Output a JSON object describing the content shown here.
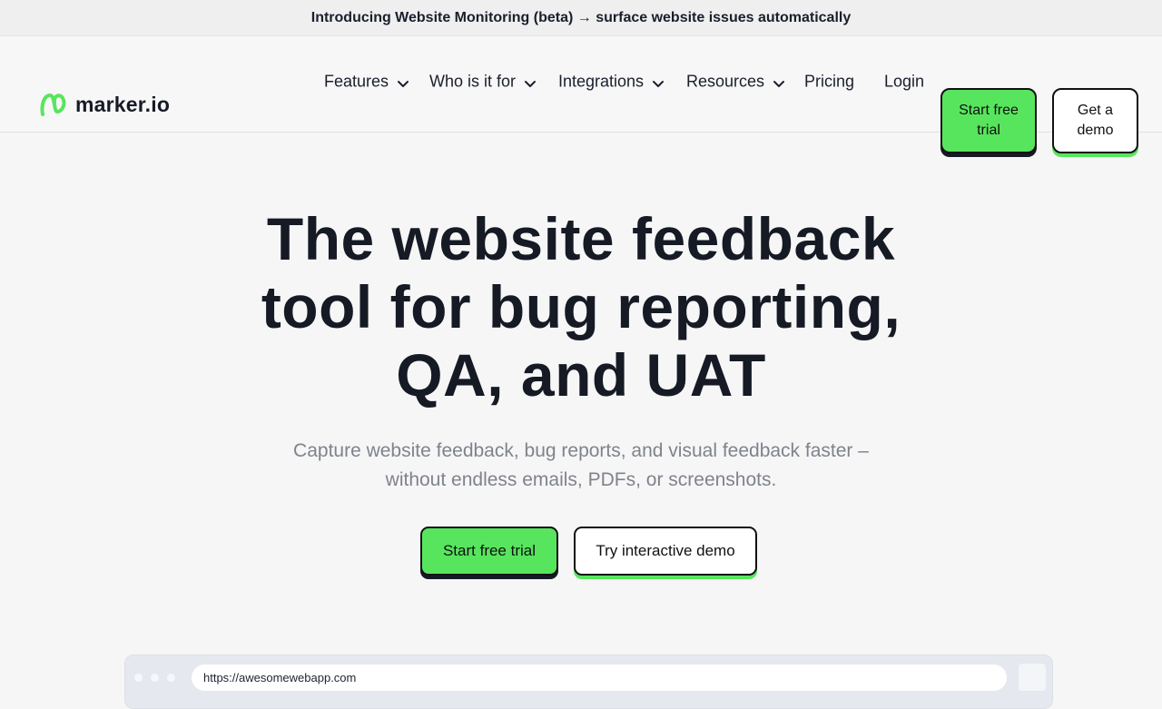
{
  "announcement": {
    "text": "Introducing Website Monitoring (beta) → surface website issues automatically"
  },
  "nav": {
    "logo_text": "marker.io",
    "logo_icon": "marker-logo-icon",
    "items": [
      {
        "label": "Features",
        "dropdown": true
      },
      {
        "label": "Who is it for",
        "dropdown": true
      },
      {
        "label": "Integrations",
        "dropdown": true
      },
      {
        "label": "Resources",
        "dropdown": true
      },
      {
        "label": "Pricing",
        "dropdown": false
      },
      {
        "label": "Login",
        "dropdown": false
      }
    ],
    "trial_button": "Start free trial",
    "demo_button": "Get a demo"
  },
  "hero": {
    "title_lines": [
      "The website feedback",
      "tool for bug reporting,",
      "QA, and UAT"
    ],
    "subtitle_lines": [
      "Capture website feedback, bug reports, and visual feedback faster –",
      "without endless emails, PDFs, or screenshots."
    ],
    "primary_cta": "Start free trial",
    "secondary_cta": "Try interactive demo"
  },
  "browser_preview": {
    "url": "https://awesomewebapp.com"
  },
  "colors": {
    "brand_green": "#58e55e",
    "text_dark": "#151a24",
    "subtitle_gray": "#7f838b",
    "background": "#f6f6f7"
  }
}
